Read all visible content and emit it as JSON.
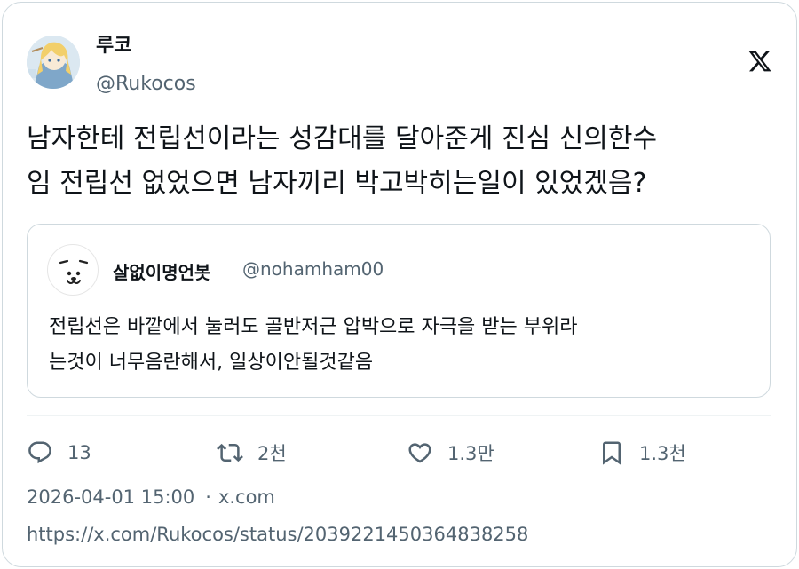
{
  "author": {
    "display_name": "루코",
    "handle": "@Rukocos"
  },
  "tweet": {
    "text_line1": "남자한테 전립선이라는 성감대를 달아준게 진심 신의한수",
    "text_line2": "임 전립선 없었으면 남자끼리 박고박히는일이 있었겠음?"
  },
  "quote": {
    "display_name": "살없이명언봇",
    "handle": "@nohamham00",
    "text_line1": "전립선은 바깥에서 눌러도 골반저근 압박으로 자극을 받는 부위라",
    "text_line2": "는것이 너무음란해서, 일상이안될것같음"
  },
  "actions": {
    "replies": "13",
    "reposts": "2천",
    "likes": "1.3만",
    "bookmarks": "1.3천"
  },
  "meta": {
    "timestamp": "2026-04-01 15:00",
    "separator": "·",
    "source": "x.com",
    "url": "https://x.com/Rukocos/status/2039221450364838258"
  },
  "icons": {
    "brand": "x-logo-icon",
    "reply": "reply-icon",
    "repost": "repost-icon",
    "like": "heart-icon",
    "bookmark": "bookmark-icon"
  },
  "colors": {
    "text": "#0f1419",
    "muted": "#536471",
    "border": "#cfd9de"
  }
}
